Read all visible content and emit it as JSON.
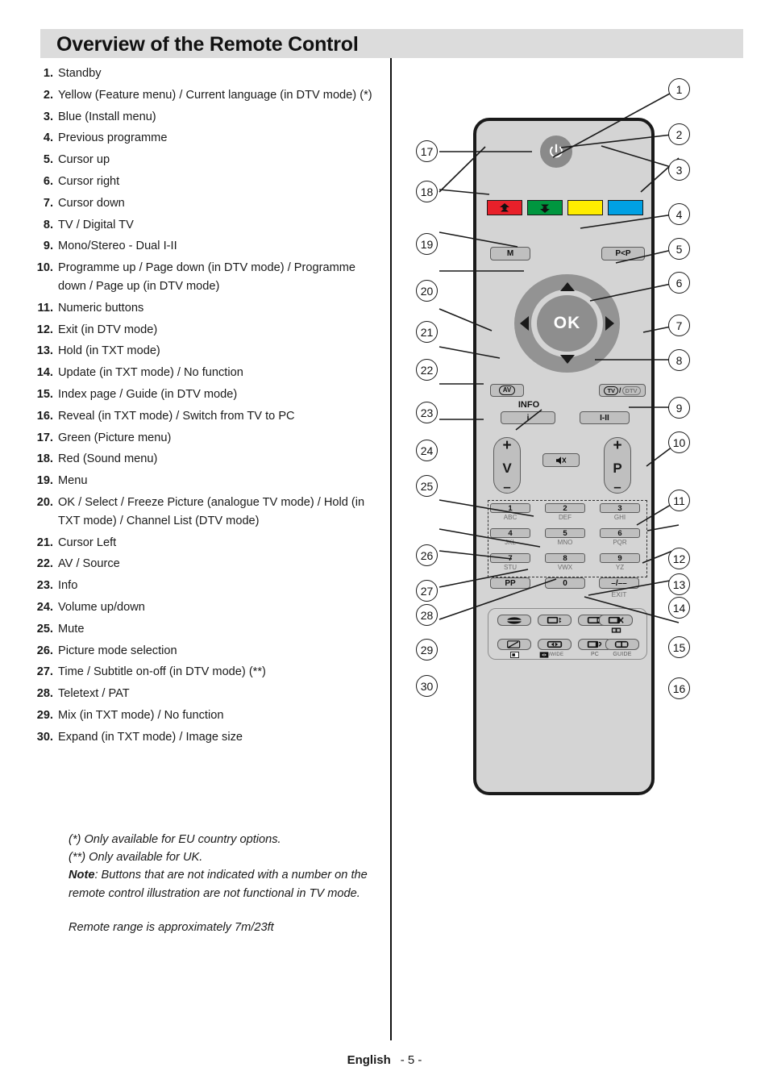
{
  "header": {
    "title": "Overview of the Remote Control"
  },
  "list": [
    {
      "num": "1.",
      "text": "Standby"
    },
    {
      "num": "2.",
      "text": "Yellow (Feature menu) / Current language (in DTV mode) (*)"
    },
    {
      "num": "3.",
      "text": "Blue (Install menu)"
    },
    {
      "num": "4.",
      "text": "Previous programme"
    },
    {
      "num": "5.",
      "text": "Cursor up"
    },
    {
      "num": "6.",
      "text": "Cursor right"
    },
    {
      "num": "7.",
      "text": "Cursor down"
    },
    {
      "num": "8.",
      "text": "TV / Digital TV"
    },
    {
      "num": "9.",
      "text": "Mono/Stereo - Dual I-II"
    },
    {
      "num": "10.",
      "text": "Programme up / Page down (in DTV mode) / Programme down / Page up (in DTV mode)"
    },
    {
      "num": "11.",
      "text": "Numeric buttons"
    },
    {
      "num": "12.",
      "text": "Exit (in DTV mode)"
    },
    {
      "num": "13.",
      "text": "Hold (in TXT mode)"
    },
    {
      "num": "14.",
      "text": "Update (in TXT mode) / No function"
    },
    {
      "num": "15.",
      "text": "Index page / Guide (in DTV mode)"
    },
    {
      "num": "16.",
      "text": "Reveal (in TXT mode) / Switch from TV to PC"
    },
    {
      "num": "17.",
      "text": "Green (Picture menu)"
    },
    {
      "num": "18.",
      "text": "Red (Sound menu)"
    },
    {
      "num": "19.",
      "text": "Menu"
    },
    {
      "num": "20.",
      "text": "OK / Select / Freeze Picture (analogue TV mode) / Hold (in TXT mode) / Channel List (DTV mode)"
    },
    {
      "num": "21.",
      "text": "Cursor Left"
    },
    {
      "num": "22.",
      "text": "AV / Source"
    },
    {
      "num": "23.",
      "text": "Info"
    },
    {
      "num": "24.",
      "text": "Volume up/down"
    },
    {
      "num": "25.",
      "text": "Mute"
    },
    {
      "num": "26.",
      "text": "Picture mode selection"
    },
    {
      "num": "27.",
      "text": "Time / Subtitle on-off (in DTV mode) (**)"
    },
    {
      "num": "28.",
      "text": "Teletext / PAT"
    },
    {
      "num": "29.",
      "text": "Mix (in TXT mode) / No function"
    },
    {
      "num": "30.",
      "text": "Expand (in TXT mode) / Image size"
    }
  ],
  "notes": {
    "line1": "(*) Only available for EU country options.",
    "line2": "(**) Only available for UK.",
    "note_label": "Note",
    "note_body": ": Buttons that are not indicated with a number on the remote control illustration are not functional in TV mode.",
    "range": "Remote range is approximately 7m/23ft"
  },
  "footer": {
    "language": "English",
    "page": "- 5 -"
  },
  "remote": {
    "power_icon": "power-icon",
    "color_keys": [
      {
        "name": "red-key",
        "color": "#e8202a",
        "icon": "up-arrow-icon"
      },
      {
        "name": "green-key",
        "color": "#00963f",
        "icon": "down-arrow-icon"
      },
      {
        "name": "yellow-key",
        "color": "#ffed00",
        "icon": ""
      },
      {
        "name": "blue-key",
        "color": "#00a0e3",
        "icon": ""
      }
    ],
    "menu_key": "M",
    "prev_prog_key": "P<P",
    "ok_label": "OK",
    "av_key": "AV",
    "tv_key": "TV",
    "tv_sep": "/",
    "dtv_key": "DTV",
    "info_label": "INFO",
    "info_key": "i",
    "dual_key": "I-II",
    "volume": {
      "plus": "+",
      "label": "V",
      "minus": "–"
    },
    "programme": {
      "plus": "+",
      "label": "P",
      "minus": "–"
    },
    "mute_icon": "mute-speaker-icon",
    "keypad": [
      {
        "digit": "1",
        "letters": "ABC"
      },
      {
        "digit": "2",
        "letters": "DEF"
      },
      {
        "digit": "3",
        "letters": "GHI"
      },
      {
        "digit": "4",
        "letters": "JKL"
      },
      {
        "digit": "5",
        "letters": "MNO"
      },
      {
        "digit": "6",
        "letters": "PQR"
      },
      {
        "digit": "7",
        "letters": "STU"
      },
      {
        "digit": "8",
        "letters": "VWX"
      },
      {
        "digit": "9",
        "letters": "YZ"
      }
    ],
    "pp_key": "PP",
    "zero_key": "0",
    "dash_key": "–/––",
    "exit_label": "EXIT",
    "function_keys": [
      {
        "name": "teletext-key",
        "icon": "teletext-icon",
        "label": ""
      },
      {
        "name": "subtitle-key",
        "icon": "subtitle-icon",
        "label": ""
      },
      {
        "name": "hold-key",
        "icon": "hold-icon",
        "label": ""
      },
      {
        "name": "update-key",
        "icon": "update-icon",
        "label": ""
      },
      {
        "name": "mix-key",
        "icon": "mix-icon",
        "label": ""
      },
      {
        "name": "expand-key",
        "icon": "expand-icon",
        "label": "/WIDE"
      },
      {
        "name": "pc-key",
        "icon": "reveal-icon",
        "label": "PC"
      },
      {
        "name": "guide-key",
        "icon": "guide-icon",
        "label": "GUIDE"
      }
    ]
  },
  "callouts": {
    "right": [
      "1",
      "2",
      "3",
      "4",
      "5",
      "6",
      "7",
      "8",
      "9",
      "10",
      "11",
      "12",
      "13",
      "14",
      "15",
      "16"
    ],
    "left": [
      "17",
      "18",
      "19",
      "20",
      "21",
      "22",
      "23",
      "24",
      "25",
      "26",
      "27",
      "28",
      "29",
      "30"
    ]
  }
}
